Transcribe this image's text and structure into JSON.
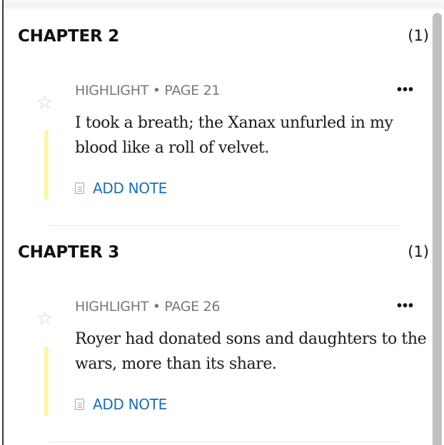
{
  "chapters": [
    {
      "title": "CHAPTER 2",
      "count": "(1)",
      "highlights": [
        {
          "meta": "HIGHLIGHT • PAGE 21",
          "text": "I took a breath; the Xanax unfurled in my blood like a roll of velvet.",
          "add_note_label": "ADD NOTE",
          "more_label": "•••",
          "star_icon": "☆",
          "highlight_color": "#fff5a8"
        }
      ]
    },
    {
      "title": "CHAPTER 3",
      "count": "(1)",
      "highlights": [
        {
          "meta": "HIGHLIGHT • PAGE 26",
          "text": "Royer had donated sons and daughters to the wars, more than its share.",
          "add_note_label": "ADD NOTE",
          "more_label": "•••",
          "star_icon": "☆",
          "highlight_color": "#fff5a8"
        }
      ]
    }
  ],
  "colors": {
    "link": "#1a6fb5",
    "meta": "#777777",
    "highlight": "#fff5a8"
  }
}
